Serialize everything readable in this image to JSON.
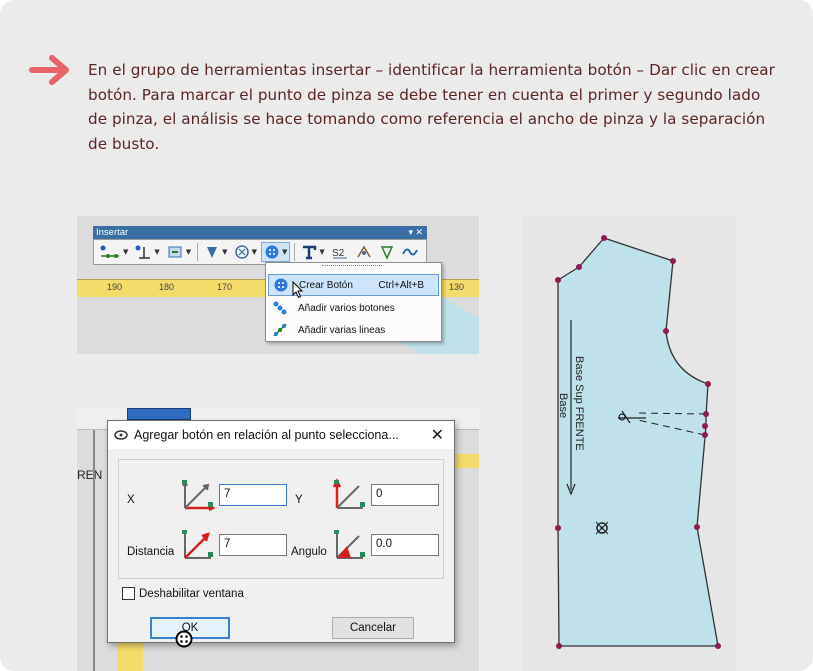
{
  "instruction": {
    "text": "En el grupo de herramientas insertar – identificar la herramienta botón – Dar clic en crear botón. Para marcar el punto de pinza se debe tener en cuenta el primer y segundo lado de pinza, el análisis se hace tomando como referencia el ancho de pinza y la separación de busto."
  },
  "colors": {
    "accent_arrow": "#e8636b",
    "text": "#5a2525",
    "card_bg": "#ebebeb",
    "pattern_fill": "#bfe1ea",
    "pattern_point": "#8c1b4f"
  },
  "toolbar": {
    "title": "Insertar",
    "controls": "▾ ✕",
    "ruler_labels": [
      "190",
      "180",
      "170",
      "130"
    ],
    "menu": {
      "items": [
        {
          "label": "Crear Botón",
          "shortcut": "Ctrl+Alt+B",
          "icon": "button-icon"
        },
        {
          "label": "Añadir varios botones",
          "shortcut": "",
          "icon": "multiple-buttons-icon"
        },
        {
          "label": "Añadir varias lineas",
          "shortcut": "",
          "icon": "multiple-lines-icon"
        }
      ]
    }
  },
  "dialog": {
    "background_text": "REN",
    "title": "Agregar botón en relación al punto selecciona...",
    "close": "✕",
    "x_label": "X",
    "x_value": "7",
    "y_label": "Y",
    "y_value": "0",
    "distance_label": "Distancia",
    "distance_value": "7",
    "angle_label": "Angulo",
    "angle_value": "0.0",
    "disable_label": "Deshabilitar ventana",
    "ok_label": "OK",
    "cancel_label": "Cancelar"
  },
  "pattern": {
    "label_line1": "Base Sup FRENTE",
    "label_line2": "Base"
  }
}
